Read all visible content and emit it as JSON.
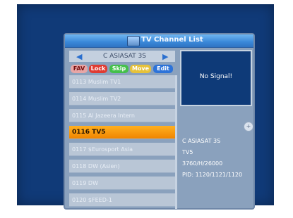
{
  "window": {
    "title": "TV Channel List"
  },
  "satellite": {
    "name": "C ASIASAT 3S"
  },
  "buttons": {
    "fav": "FAV",
    "lock": "Lock",
    "skip": "Skip",
    "move": "Move",
    "edit": "Edit"
  },
  "channels": [
    "0113 Muslim TV1",
    "0114 Muslim TV2",
    "0115 Al Jazeera Intern",
    "0116 TV5",
    "0117 $Eurosport Asia",
    "0118 DW (Asien)",
    "0119 DW",
    "0120 $FEED-1"
  ],
  "selected_index": 3,
  "preview": {
    "status": "No Signal!"
  },
  "details": {
    "satellite": "C ASIASAT 3S",
    "channel": "TV5",
    "transponder": "3760/H/26000",
    "pid": "PID: 1120/1121/1120"
  },
  "colors": {
    "panel": "#8aa1bd",
    "selected": "#f08500",
    "screen": "#103a78"
  }
}
